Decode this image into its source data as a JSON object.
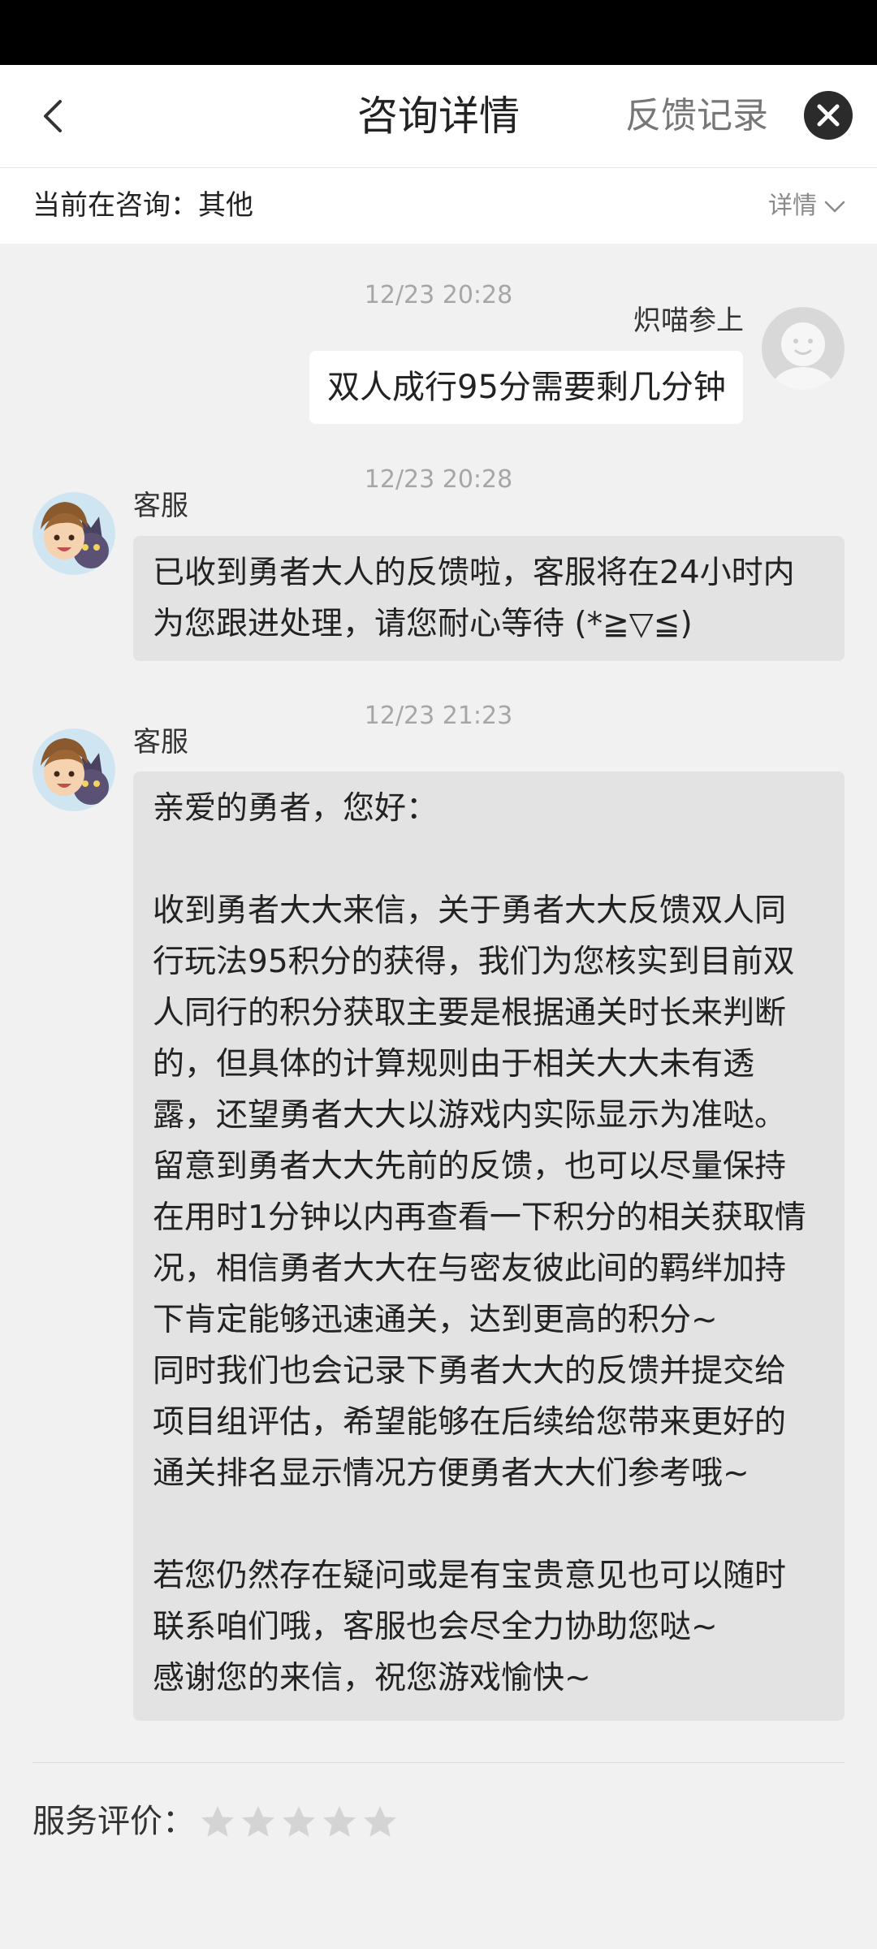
{
  "header": {
    "title": "咨询详情",
    "feedback_link": "反馈记录",
    "back_icon": "chevron-left-icon",
    "close_icon": "close-icon"
  },
  "subheader": {
    "consulting_label": "当前在咨询：其他",
    "details_label": "详情",
    "details_icon": "chevron-down-icon"
  },
  "messages": [
    {
      "timestamp": "12/23 20:28",
      "sender": "炽喵参上",
      "side": "right",
      "lines": [
        "双人成行95分需要剩几分钟"
      ]
    },
    {
      "timestamp": "12/23 20:28",
      "sender": "客服",
      "side": "left",
      "lines": [
        "已收到勇者大人的反馈啦，客服将在24小时内",
        "为您跟进处理，请您耐心等待 (*≧▽≦)"
      ]
    },
    {
      "timestamp": "12/23 21:23",
      "sender": "客服",
      "side": "left",
      "lines": [
        "亲爱的勇者，您好：",
        "",
        "收到勇者大大来信，关于勇者大大反馈双人同",
        "行玩法95积分的获得，我们为您核实到目前双",
        "人同行的积分获取主要是根据通关时长来判断",
        "的，但具体的计算规则由于相关大大未有透",
        "露，还望勇者大大以游戏内实际显示为准哒。",
        "留意到勇者大大先前的反馈，也可以尽量保持",
        "在用时1分钟以内再查看一下积分的相关获取情",
        "况，相信勇者大大在与密友彼此间的羁绊加持",
        "下肯定能够迅速通关，达到更高的积分~",
        "同时我们也会记录下勇者大大的反馈并提交给",
        "项目组评估，希望能够在后续给您带来更好的",
        "通关排名显示情况方便勇者大大们参考哦~",
        "",
        "若您仍然存在疑问或是有宝贵意见也可以随时",
        "联系咱们哦，客服也会尽全力协助您哒~",
        "感谢您的来信，祝您游戏愉快~"
      ]
    }
  ],
  "rating": {
    "label": "服务评价：",
    "max_stars": 5,
    "selected_stars": 0,
    "star_icon": "star-icon",
    "star_color": "#d4d4d4"
  },
  "colors": {
    "background": "#f1f1f1",
    "bubble_user": "#ffffff",
    "bubble_cs": "#e3e3e3",
    "timestamp": "#a6a6a6"
  }
}
